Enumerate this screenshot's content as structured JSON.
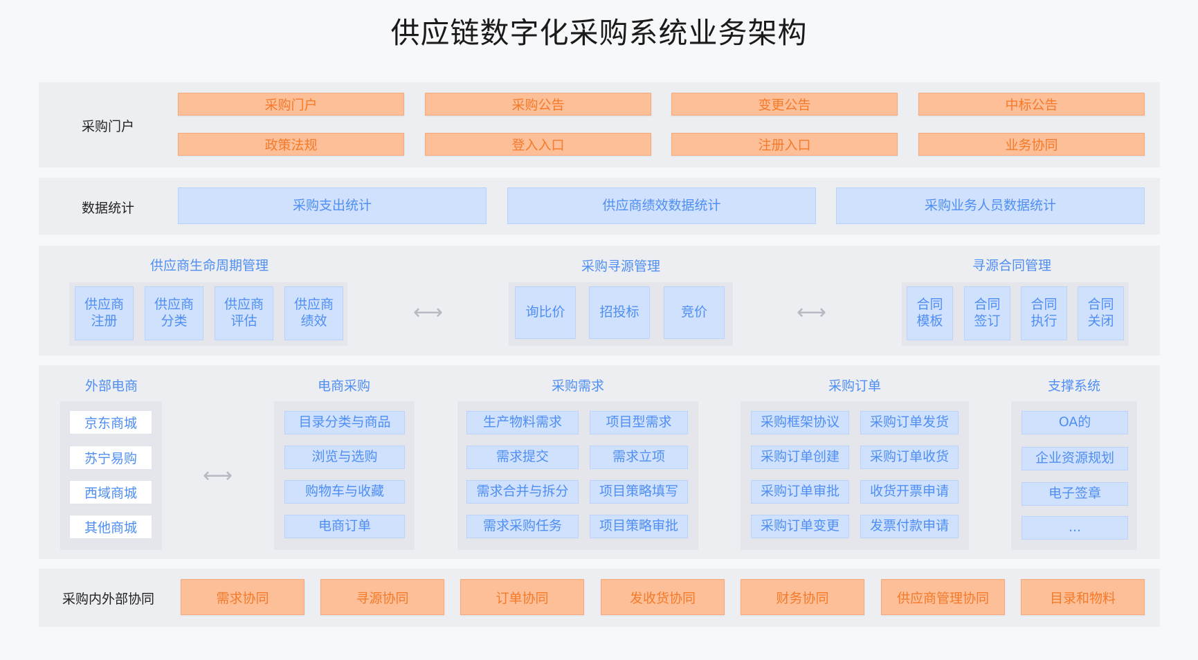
{
  "title": "供应链数字化采购系统业务架构",
  "portal": {
    "label": "采购门户",
    "items": [
      "采购门户",
      "采购公告",
      "变更公告",
      "中标公告",
      "政策法规",
      "登入入口",
      "注册入口",
      "业务协同"
    ]
  },
  "stats": {
    "label": "数据统计",
    "items": [
      "采购支出统计",
      "供应商绩效数据统计",
      "采购业务人员数据统计"
    ]
  },
  "supplier": {
    "title": "供应商生命周期管理",
    "items": [
      "供应商\n注册",
      "供应商\n分类",
      "供应商\n评估",
      "供应商\n绩效"
    ]
  },
  "sourcing": {
    "title": "采购寻源管理",
    "items": [
      "询比价",
      "招投标",
      "竞价"
    ]
  },
  "contract": {
    "title": "寻源合同管理",
    "items": [
      "合同\n模板",
      "合同\n签订",
      "合同\n执行",
      "合同\n关闭"
    ]
  },
  "external": {
    "title": "外部电商",
    "items": [
      "京东商城",
      "苏宁易购",
      "西域商城",
      "其他商城"
    ]
  },
  "ecommerce": {
    "title": "电商采购",
    "items": [
      "目录分类与商品",
      "浏览与选购",
      "购物车与收藏",
      "电商订单"
    ]
  },
  "demand": {
    "title": "采购需求",
    "left": [
      "生产物料需求",
      "需求提交",
      "需求合并与拆分",
      "需求采购任务"
    ],
    "right": [
      "项目型需求",
      "需求立项",
      "项目策略填写",
      "项目策略审批"
    ]
  },
  "order": {
    "title": "采购订单",
    "left": [
      "采购框架协议",
      "采购订单创建",
      "采购订单审批",
      "采购订单变更"
    ],
    "right": [
      "采购订单发货",
      "采购订单收货",
      "收货开票申请",
      "发票付款申请"
    ]
  },
  "support": {
    "title": "支撑系统",
    "items": [
      "OA的",
      "企业资源规划",
      "电子签章",
      "..."
    ]
  },
  "collab": {
    "label": "采购内外部协同",
    "items": [
      "需求协同",
      "寻源协同",
      "订单协同",
      "发收货协同",
      "财务协同",
      "供应商管理协同",
      "目录和物料"
    ]
  },
  "arrow_glyph": "⟷"
}
